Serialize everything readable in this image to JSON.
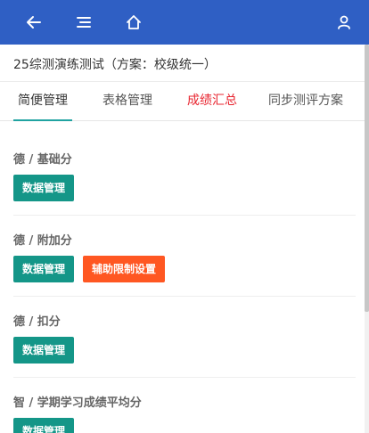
{
  "header": {
    "icons": [
      "back-arrow-icon",
      "menu-icon",
      "home-icon",
      "user-icon"
    ],
    "background_color": "#2f5fc4"
  },
  "page": {
    "title": "25综测演练测试（方案：校级统一）"
  },
  "tabs": [
    {
      "label": "简便管理",
      "active": true
    },
    {
      "label": "表格管理",
      "active": false
    },
    {
      "label": "成绩汇总",
      "active": false,
      "color": "#e8242f"
    },
    {
      "label": "同步测评方案",
      "active": false
    }
  ],
  "sections": [
    {
      "title": "德 / 基础分",
      "buttons": [
        {
          "label": "数据管理",
          "color": "#149688"
        }
      ]
    },
    {
      "title": "德 / 附加分",
      "buttons": [
        {
          "label": "数据管理",
          "color": "#149688"
        },
        {
          "label": "辅助限制设置",
          "color": "#ff5722"
        }
      ]
    },
    {
      "title": "德 / 扣分",
      "buttons": [
        {
          "label": "数据管理",
          "color": "#149688"
        }
      ]
    },
    {
      "title": "智 / 学期学习成绩平均分",
      "buttons": [
        {
          "label": "数据管理",
          "color": "#149688"
        }
      ]
    }
  ]
}
